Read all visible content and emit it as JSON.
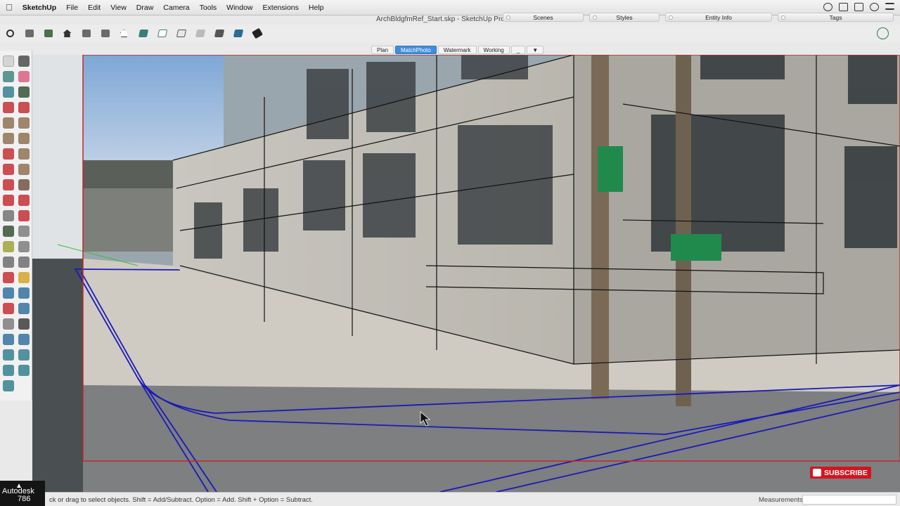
{
  "menubar": {
    "app_name": "SketchUp",
    "items": [
      "File",
      "Edit",
      "View",
      "Draw",
      "Camera",
      "Tools",
      "Window",
      "Extensions",
      "Help"
    ]
  },
  "window": {
    "title": "ArchBldgfmRef_Start.skp - SketchUp Pro"
  },
  "panels": [
    "Scenes",
    "Styles",
    "Entity Info",
    "Tags"
  ],
  "scene_tabs": [
    "Plan",
    "MatchPhoto",
    "Watermark",
    "Working",
    "_"
  ],
  "scene_tabs_active": "MatchPhoto",
  "status": {
    "hint": "ck or drag to select objects. Shift = Add/Subtract. Option = Add. Shift + Option = Subtract.",
    "measurements_label": "Measurements",
    "measurements_value": ""
  },
  "overlay": {
    "autodesk_line1": "Autodesk",
    "autodesk_line2": "786",
    "subscribe": "SUBSCRIBE"
  },
  "colors": {
    "accent": "#3d8edb",
    "guide_blue": "#1a1ab8",
    "frame_red": "#c1272d",
    "subscribe_red": "#d6141f"
  },
  "icons": [
    "apple-icon",
    "search-icon",
    "home-icon",
    "styles-icon",
    "eraser-icon",
    "account-icon"
  ]
}
